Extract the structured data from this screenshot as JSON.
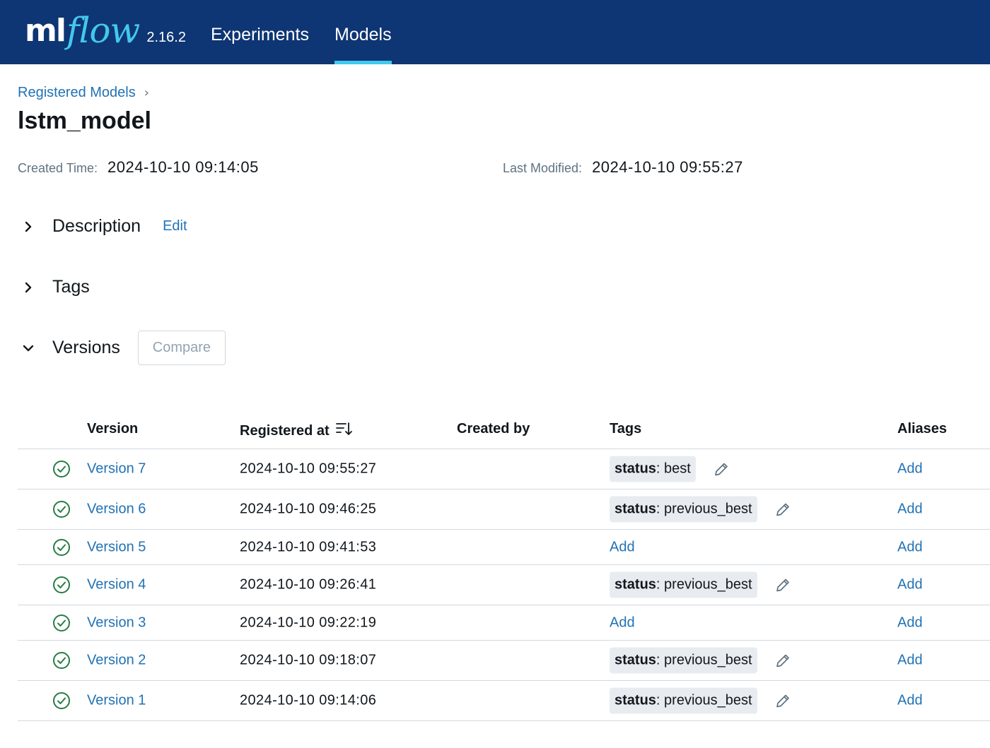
{
  "header": {
    "logo_ml": "ml",
    "logo_flow": "flow",
    "version": "2.16.2",
    "nav": [
      {
        "label": "Experiments"
      },
      {
        "label": "Models"
      }
    ],
    "colors": {
      "bar": "#0e3574",
      "accent": "#43c9ed"
    }
  },
  "breadcrumb": {
    "parent": "Registered Models",
    "separator": "›"
  },
  "model": {
    "name": "lstm_model",
    "created_label": "Created Time:",
    "created_value": "2024-10-10 09:14:05",
    "modified_label": "Last Modified:",
    "modified_value": "2024-10-10 09:55:27"
  },
  "sections": {
    "description": {
      "title": "Description",
      "edit_label": "Edit",
      "icon": "chevron-right-icon"
    },
    "tags": {
      "title": "Tags",
      "icon": "chevron-right-icon"
    },
    "versions": {
      "title": "Versions",
      "compare_label": "Compare",
      "icon": "chevron-down-icon"
    }
  },
  "table": {
    "columns": {
      "version": "Version",
      "registered_at": "Registered at",
      "created_by": "Created by",
      "tags": "Tags",
      "aliases": "Aliases"
    },
    "rows": [
      {
        "version": "Version 7",
        "registered": "2024-10-10 09:55:27",
        "created_by": "",
        "tag_key": "status",
        "tag_value": "best",
        "tag_add": "",
        "alias": "Add"
      },
      {
        "version": "Version 6",
        "registered": "2024-10-10 09:46:25",
        "created_by": "",
        "tag_key": "status",
        "tag_value": "previous_best",
        "tag_add": "",
        "alias": "Add"
      },
      {
        "version": "Version 5",
        "registered": "2024-10-10 09:41:53",
        "created_by": "",
        "tag_key": "",
        "tag_value": "",
        "tag_add": "Add",
        "alias": "Add"
      },
      {
        "version": "Version 4",
        "registered": "2024-10-10 09:26:41",
        "created_by": "",
        "tag_key": "status",
        "tag_value": "previous_best",
        "tag_add": "",
        "alias": "Add"
      },
      {
        "version": "Version 3",
        "registered": "2024-10-10 09:22:19",
        "created_by": "",
        "tag_key": "",
        "tag_value": "",
        "tag_add": "Add",
        "alias": "Add"
      },
      {
        "version": "Version 2",
        "registered": "2024-10-10 09:18:07",
        "created_by": "",
        "tag_key": "status",
        "tag_value": "previous_best",
        "tag_add": "",
        "alias": "Add"
      },
      {
        "version": "Version 1",
        "registered": "2024-10-10 09:14:06",
        "created_by": "",
        "tag_key": "status",
        "tag_value": "previous_best",
        "tag_add": "",
        "alias": "Add"
      }
    ],
    "status_icon": "check-circle-icon",
    "status_color": "#277c43",
    "edit_icon": "pencil-icon"
  }
}
